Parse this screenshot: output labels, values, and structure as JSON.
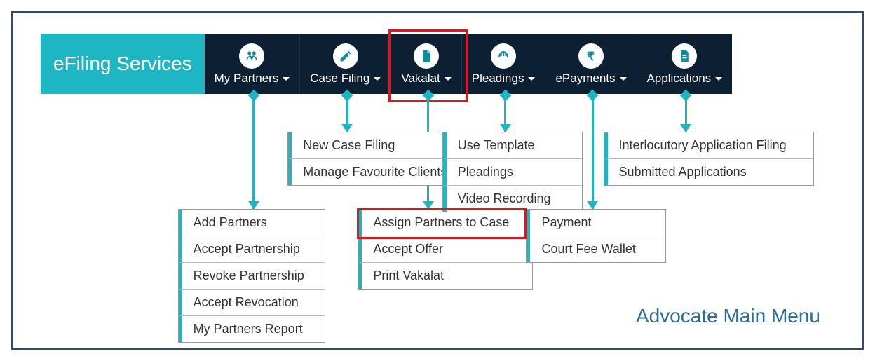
{
  "brand": {
    "label": "eFiling Services"
  },
  "nav": {
    "my_partners": {
      "label": "My Partners",
      "icon": "partners-icon"
    },
    "case_filing": {
      "label": "Case Filing",
      "icon": "pencil-icon"
    },
    "vakalat": {
      "label": "Vakalat",
      "icon": "document-icon"
    },
    "pleadings": {
      "label": "Pleadings",
      "icon": "hands-icon"
    },
    "epayments": {
      "label": "ePayments",
      "icon": "rupee-icon"
    },
    "applications": {
      "label": "Applications",
      "icon": "file-icon"
    }
  },
  "dropdowns": {
    "my_partners": {
      "items": [
        {
          "label": "Add Partners"
        },
        {
          "label": "Accept Partnership"
        },
        {
          "label": "Revoke Partnership"
        },
        {
          "label": "Accept Revocation"
        },
        {
          "label": "My Partners Report"
        }
      ]
    },
    "case_filing": {
      "items": [
        {
          "label": "New Case Filing"
        },
        {
          "label": "Manage Favourite Clients"
        }
      ]
    },
    "vakalat": {
      "items": [
        {
          "label": "Assign Partners to Case"
        },
        {
          "label": "Accept Offer"
        },
        {
          "label": "Print Vakalat"
        }
      ]
    },
    "pleadings": {
      "items": [
        {
          "label": "Use Template"
        },
        {
          "label": "Pleadings"
        },
        {
          "label": "Video Recording"
        }
      ]
    },
    "epayments": {
      "items": [
        {
          "label": "Payment"
        },
        {
          "label": "Court Fee Wallet"
        }
      ]
    },
    "applications": {
      "items": [
        {
          "label": "Interlocutory Application Filing"
        },
        {
          "label": "Submitted Applications"
        }
      ]
    }
  },
  "highlights": {
    "nav_highlighted": "vakalat",
    "item_highlighted": "Assign Partners to Case"
  },
  "caption": "Advocate Main Menu",
  "colors": {
    "accent": "#1fb6c4",
    "navbg": "#0c1f33",
    "highlight": "#d71920",
    "caption": "#2a6d97"
  }
}
